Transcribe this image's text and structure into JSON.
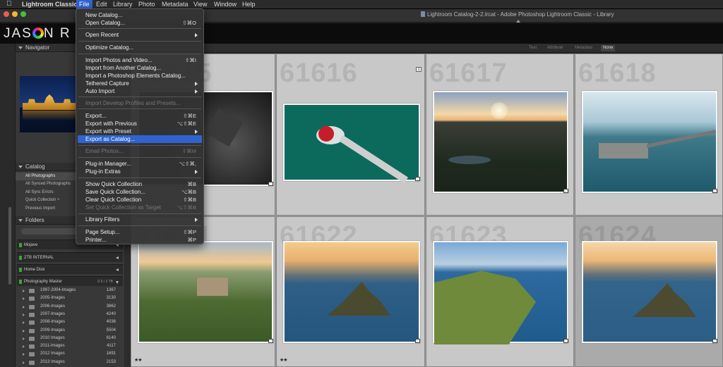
{
  "menubar": {
    "items": [
      {
        "label": "Lightroom Classic",
        "bold": true
      },
      {
        "label": "File",
        "active": true
      },
      {
        "label": "Edit"
      },
      {
        "label": "Library"
      },
      {
        "label": "Photo"
      },
      {
        "label": "Metadata"
      },
      {
        "label": "View"
      },
      {
        "label": "Window"
      },
      {
        "label": "Help"
      }
    ]
  },
  "window": {
    "title": "Lightroom Catalog-2-2.lrcat - Adobe Photoshop Lightroom Classic - Library"
  },
  "identity_plate": {
    "text_before": "JAS",
    "text_after": "N R"
  },
  "left_panel": {
    "navigator": {
      "label": "Navigator"
    },
    "catalog": {
      "label": "Catalog",
      "items": [
        "All Photographs",
        "All Synced Photographs",
        "All Sync Errors",
        "Quick Collection +",
        "Previous Import"
      ]
    },
    "folders": {
      "label": "Folders",
      "volumes": [
        {
          "name": "Mojave",
          "size": "",
          "expanded": false
        },
        {
          "name": "2TB INTERNAL",
          "size": "",
          "expanded": false
        },
        {
          "name": "Home Disk",
          "size": "",
          "expanded": false
        },
        {
          "name": "Photography Master",
          "size": "0.9 / 2 TB",
          "expanded": true
        }
      ],
      "items": [
        {
          "name": "1997-2004-Images",
          "count": "1367"
        },
        {
          "name": "2005-Images",
          "count": "3130"
        },
        {
          "name": "2006-Images",
          "count": "3862"
        },
        {
          "name": "2007-Images",
          "count": "4240"
        },
        {
          "name": "2008-Images",
          "count": "4036"
        },
        {
          "name": "2009-Images",
          "count": "5504"
        },
        {
          "name": "2010 Images",
          "count": "6140"
        },
        {
          "name": "2011-Images",
          "count": "4117"
        },
        {
          "name": "2012 Images",
          "count": "1691"
        },
        {
          "name": "2013 Images",
          "count": "2153"
        }
      ]
    }
  },
  "toolbar": {
    "filters": [
      {
        "label": "Text",
        "on": false
      },
      {
        "label": "Attribute",
        "on": false
      },
      {
        "label": "Metadata",
        "on": false
      },
      {
        "label": "None",
        "on": true
      }
    ]
  },
  "grid": {
    "cells": [
      {
        "number": "61615",
        "scene": "aerial-dark",
        "badge": "",
        "stars": ""
      },
      {
        "number": "61616",
        "scene": "boat-teal",
        "badge": "1",
        "stars": ""
      },
      {
        "number": "61617",
        "scene": "sunset-town",
        "badge": "",
        "stars": ""
      },
      {
        "number": "61618",
        "scene": "pier-sea",
        "badge": "",
        "stars": ""
      },
      {
        "number": "61621",
        "scene": "castle-green",
        "badge": "",
        "stars": "★★"
      },
      {
        "number": "61622",
        "scene": "island-sunset",
        "badge": "",
        "stars": "★★"
      },
      {
        "number": "61623",
        "scene": "cliffs-coast",
        "badge": "",
        "stars": ""
      },
      {
        "number": "61624",
        "scene": "island-sunset-2",
        "badge": "",
        "stars": ""
      }
    ]
  },
  "file_menu": {
    "groups": [
      [
        {
          "label": "New Catalog...",
          "shortcut": "",
          "enabled": true
        },
        {
          "label": "Open Catalog...",
          "shortcut": "⇧⌘O",
          "enabled": true
        }
      ],
      [
        {
          "label": "Open Recent",
          "submenu": true,
          "enabled": true
        }
      ],
      [
        {
          "label": "Optimize Catalog...",
          "enabled": true
        }
      ],
      [
        {
          "label": "Import Photos and Video...",
          "shortcut": "⇧⌘I",
          "enabled": true
        },
        {
          "label": "Import from Another Catalog...",
          "enabled": true
        },
        {
          "label": "Import a Photoshop Elements Catalog...",
          "enabled": true
        },
        {
          "label": "Tethered Capture",
          "submenu": true,
          "enabled": true
        },
        {
          "label": "Auto Import",
          "submenu": true,
          "enabled": true
        }
      ],
      [
        {
          "label": "Import Develop Profiles and Presets...",
          "enabled": false
        }
      ],
      [
        {
          "label": "Export...",
          "shortcut": "⇧⌘E",
          "enabled": true
        },
        {
          "label": "Export with Previous",
          "shortcut": "⌥⇧⌘E",
          "enabled": true
        },
        {
          "label": "Export with Preset",
          "submenu": true,
          "enabled": true
        },
        {
          "label": "Export as Catalog...",
          "enabled": true,
          "highlighted": true
        }
      ],
      [
        {
          "label": "Email Photos...",
          "shortcut": "⇧⌘M",
          "enabled": false
        }
      ],
      [
        {
          "label": "Plug-in Manager...",
          "shortcut": "⌥⇧⌘,",
          "enabled": true
        },
        {
          "label": "Plug-in Extras",
          "submenu": true,
          "enabled": true
        }
      ],
      [
        {
          "label": "Show Quick Collection",
          "shortcut": "⌘B",
          "enabled": true
        },
        {
          "label": "Save Quick Collection...",
          "shortcut": "⌥⌘B",
          "enabled": true
        },
        {
          "label": "Clear Quick Collection",
          "shortcut": "⇧⌘B",
          "enabled": true
        },
        {
          "label": "Set Quick Collection as Target",
          "shortcut": "⌥⇧⌘B",
          "enabled": false
        }
      ],
      [
        {
          "label": "Library Filters",
          "submenu": true,
          "enabled": true
        }
      ],
      [
        {
          "label": "Page Setup...",
          "shortcut": "⇧⌘P",
          "enabled": true
        },
        {
          "label": "Printer...",
          "shortcut": "⌘P",
          "enabled": true
        }
      ]
    ]
  }
}
